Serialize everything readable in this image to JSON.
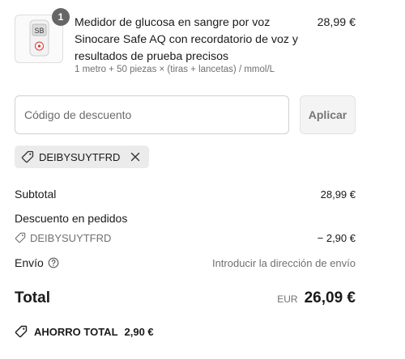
{
  "product": {
    "quantity_badge": "1",
    "title": "Medidor de glucosa en sangre por voz Sinocare Safe AQ con recordatorio de voz y resultados de prueba precisos",
    "variant": "1 metro + 50 piezas × (tiras + lancetas) / mmol/L",
    "price": "28,99 €",
    "image_screen_text": "SB"
  },
  "discount": {
    "placeholder": "Código de descuento",
    "apply_label": "Aplicar",
    "applied_code": "DEIBYSUYTFRD"
  },
  "summary": {
    "subtotal_label": "Subtotal",
    "subtotal_value": "28,99 €",
    "order_discount_label": "Descuento en pedidos",
    "order_discount_code": "DEIBYSUYTFRD",
    "order_discount_value": "− 2,90 €",
    "shipping_label": "Envío",
    "shipping_value": "Introducir la dirección de envío",
    "total_label": "Total",
    "total_currency": "EUR",
    "total_value": "26,09 €",
    "savings_label": "AHORRO TOTAL",
    "savings_value": "2,90 €"
  },
  "colors": {
    "chip_bg": "#ebebeb",
    "badge_bg": "#666666",
    "muted_text": "#707070"
  }
}
